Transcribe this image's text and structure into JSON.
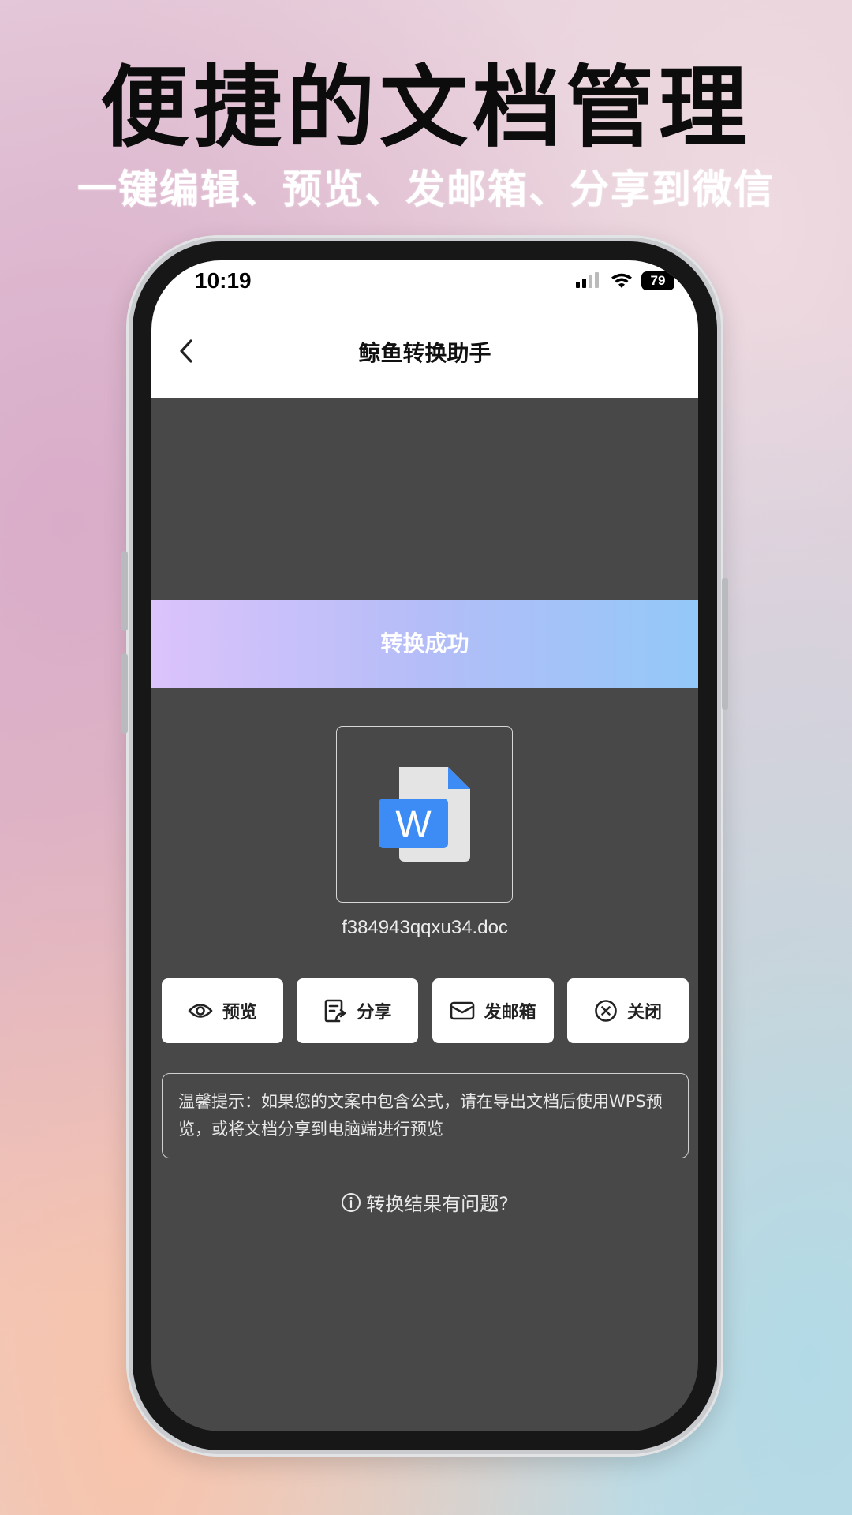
{
  "promo": {
    "headline": "便捷的文档管理",
    "subline": "一键编辑、预览、发邮箱、分享到微信"
  },
  "status_bar": {
    "time": "10:19",
    "battery": "79",
    "icons": [
      "signal-icon",
      "wifi-icon",
      "battery-icon"
    ]
  },
  "nav": {
    "back_icon": "chevron-left-icon",
    "title": "鲸鱼转换助手"
  },
  "banner": {
    "text": "转换成功"
  },
  "file": {
    "icon": "word-document-icon",
    "name": "f384943qqxu34.doc"
  },
  "actions": [
    {
      "label": "预览",
      "icon": "eye-icon"
    },
    {
      "label": "分享",
      "icon": "share-document-icon"
    },
    {
      "label": "发邮箱",
      "icon": "mail-icon"
    },
    {
      "label": "关闭",
      "icon": "close-circle-icon"
    }
  ],
  "tip": {
    "text": "温馨提示：如果您的文案中包含公式，请在导出文档后使用WPS预览，或将文档分享到电脑端进行预览"
  },
  "help": {
    "icon": "info-icon",
    "text": "转换结果有问题?"
  },
  "colors": {
    "screen_bg": "#484848",
    "banner_start": "#dcc3fb",
    "banner_end": "#93c8f8",
    "word_blue": "#3d8cf5"
  }
}
